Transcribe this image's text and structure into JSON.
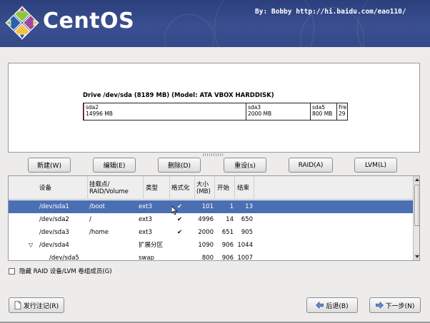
{
  "header": {
    "brand": "CentOS",
    "credit": "By: Bobby http://hi.baidu.com/eao110/"
  },
  "disk": {
    "drive_title": "Drive /dev/sda (8189 MB) (Model: ATA VBOX HARDDISK)",
    "segments": [
      {
        "name": "sda2",
        "size": "14996 MB"
      },
      {
        "name": "sda3",
        "size": "2000 MB"
      },
      {
        "name": "sda5",
        "size": "800 MB"
      },
      {
        "name": "Fre",
        "size": "29"
      }
    ]
  },
  "buttons": {
    "new": "新建(W)",
    "edit": "编辑(E)",
    "delete": "删除(D)",
    "reset": "重设(s)",
    "raid": "RAID(A)",
    "lvm": "LVM(L)"
  },
  "table": {
    "headers": {
      "device": "设备",
      "mount": "挂载点/\nRAID/Volume",
      "type": "类型",
      "format": "格式化",
      "size": "大小\n(MB)",
      "start": "开始",
      "end": "结束"
    },
    "rows": [
      {
        "device": "/dev/sda1",
        "mount": "/boot",
        "type": "ext3",
        "format": "✔",
        "size": "101",
        "start": "1",
        "end": "13",
        "selected": true
      },
      {
        "device": "/dev/sda2",
        "mount": "/",
        "type": "ext3",
        "format": "✔",
        "size": "4996",
        "start": "14",
        "end": "650"
      },
      {
        "device": "/dev/sda3",
        "mount": "/home",
        "type": "ext3",
        "format": "✔",
        "size": "2000",
        "start": "651",
        "end": "905"
      },
      {
        "device": "/dev/sda4",
        "mount": "",
        "type": "扩展分区",
        "format": "",
        "size": "1090",
        "start": "906",
        "end": "1044",
        "expander": "▽"
      },
      {
        "device": "/dev/sda5",
        "mount": "",
        "type": "swap",
        "format": "",
        "size": "800",
        "start": "906",
        "end": "1007"
      }
    ]
  },
  "hide_raid_checkbox": {
    "label": "隐藏 RAID 设备/LVM 卷组成员(G)",
    "checked": false
  },
  "footer": {
    "release_notes": "发行注记(R)",
    "back": "后退(B)",
    "next": "下一步(N)"
  },
  "colors": {
    "header": "#2c3f7d",
    "selection": "#4b6fb3",
    "logo_green": "#8fc43f",
    "logo_purple": "#9c4a9c",
    "logo_yellow": "#f3c242",
    "logo_blue": "#2b5fa8"
  }
}
